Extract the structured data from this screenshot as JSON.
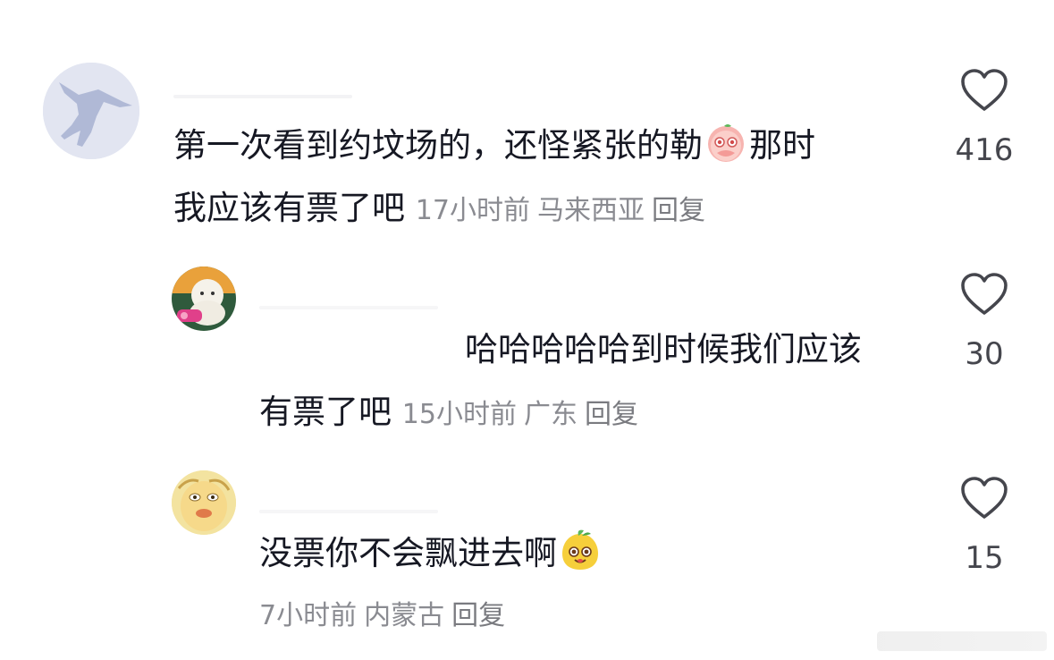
{
  "comments": [
    {
      "id": 1,
      "text_lines": [
        "第一次看到约坟场的，还怪紧张的勒",
        "那时",
        "我应该有票了吧"
      ],
      "emoji": "blushing-peach-emoji",
      "time": "17小时前",
      "location": "马来西亚",
      "reply_label": "回复",
      "likes": "416"
    },
    {
      "id": 2,
      "text_lines": [
        "哈哈哈哈哈到时候我们应该",
        "有票了吧"
      ],
      "time": "15小时前",
      "location": "广东",
      "reply_label": "回复",
      "likes": "30"
    },
    {
      "id": 3,
      "text_lines": [
        "没票你不会飘进去啊"
      ],
      "emoji": "yellow-sprout-face-emoji",
      "time": "7小时前",
      "location": "内蒙古",
      "reply_label": "回复",
      "likes": "15"
    }
  ],
  "icons": {
    "like": "heart-outline-icon"
  },
  "colors": {
    "text": "#161823",
    "meta": "#8a8b91",
    "icon": "#45464d"
  }
}
